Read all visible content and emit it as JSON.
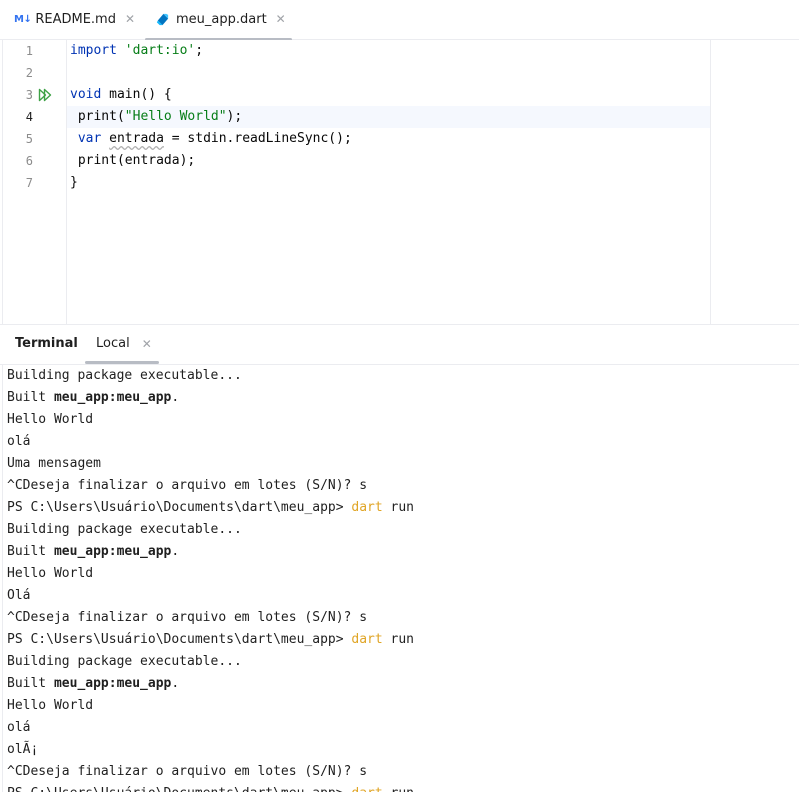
{
  "tabs": [
    {
      "icon": "markdown-icon",
      "icon_text": "M↓",
      "label": "README.md",
      "active": false
    },
    {
      "icon": "dart-icon",
      "label": "meu_app.dart",
      "active": true
    }
  ],
  "editor": {
    "line_numbers": [
      "1",
      "2",
      "3",
      "4",
      "5",
      "6",
      "7"
    ],
    "current_line": 4,
    "lines": {
      "l1_kw": "import",
      "l1_str": "'dart:io'",
      "l1_end": ";",
      "l3_kw": "void",
      "l3_rest": " main() {",
      "l4_a": " print(",
      "l4_str": "\"Hello World\"",
      "l4_b": ");",
      "l5_kw": " var",
      "l5_sp": " ",
      "l5_var": "entrada",
      "l5_rest": " = stdin.readLineSync();",
      "l6": " print(entrada);",
      "l7": "}"
    }
  },
  "terminal": {
    "title": "Terminal",
    "tab_label": "Local",
    "lines": [
      {
        "text": "Building package executable..."
      },
      {
        "prefix": "Built ",
        "bold": "meu_app:meu_app",
        "suffix": "."
      },
      {
        "text": "Hello World"
      },
      {
        "text": "olá"
      },
      {
        "text": "Uma mensagem"
      },
      {
        "text": "^CDeseja finalizar o arquivo em lotes (S/N)? s"
      },
      {
        "prompt": "PS C:\\Users\\Usuário\\Documents\\dart\\meu_app> ",
        "cmd": "dart",
        "arg": " run"
      },
      {
        "text": "Building package executable..."
      },
      {
        "prefix": "Built ",
        "bold": "meu_app:meu_app",
        "suffix": "."
      },
      {
        "text": "Hello World"
      },
      {
        "text": "Olá"
      },
      {
        "text": "^CDeseja finalizar o arquivo em lotes (S/N)? s"
      },
      {
        "prompt": "PS C:\\Users\\Usuário\\Documents\\dart\\meu_app> ",
        "cmd": "dart",
        "arg": " run"
      },
      {
        "text": "Building package executable..."
      },
      {
        "prefix": "Built ",
        "bold": "meu_app:meu_app",
        "suffix": "."
      },
      {
        "text": "Hello World"
      },
      {
        "text": "olá"
      },
      {
        "text": "olÃ¡"
      },
      {
        "text": "^CDeseja finalizar o arquivo em lotes (S/N)? s"
      },
      {
        "prompt": "PS C:\\Users\\Usuário\\Documents\\dart\\meu_app> ",
        "cmd": "dart",
        "arg": " run"
      }
    ]
  },
  "colors": {
    "keyword": "#0033b3",
    "string": "#067d17",
    "command": "#e0a526",
    "run_icon": "#3fa246",
    "accent": "#3574f0"
  }
}
